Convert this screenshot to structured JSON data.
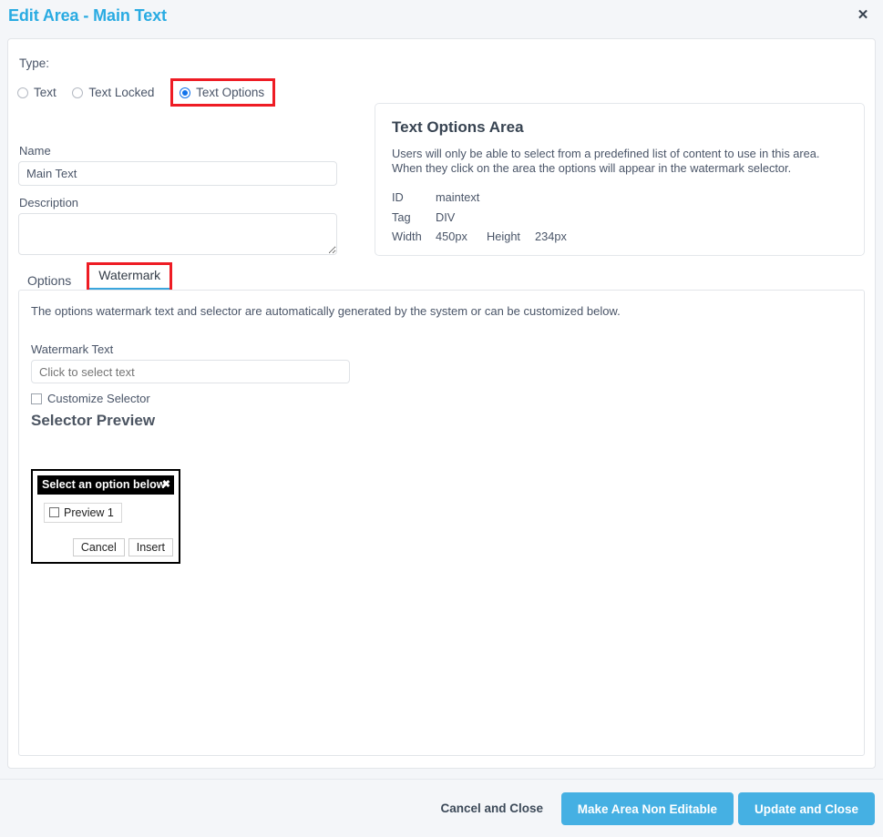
{
  "header": {
    "title": "Edit Area - Main Text",
    "close_icon": "close-icon",
    "close_glyph": "✕"
  },
  "form": {
    "type_label": "Type:",
    "type_options": [
      {
        "label": "Text",
        "selected": false
      },
      {
        "label": "Text Locked",
        "selected": false
      },
      {
        "label": "Text Options",
        "selected": true,
        "highlighted": true
      }
    ],
    "name_label": "Name",
    "name_value": "Main Text",
    "name_placeholder": "",
    "description_label": "Description",
    "description_value": "",
    "description_placeholder": ""
  },
  "info_card": {
    "title": "Text Options Area",
    "description": "Users will only be able to select from a predefined list of content to use in this area. When they click on the area the options will appear in the watermark selector.",
    "rows": [
      {
        "key": "ID",
        "value": "maintext"
      },
      {
        "key": "Tag",
        "value": "DIV"
      }
    ],
    "width_key": "Width",
    "width_value": "450px",
    "height_key": "Height",
    "height_value": "234px"
  },
  "tabs": [
    {
      "label": "Options",
      "active": false
    },
    {
      "label": "Watermark",
      "active": true,
      "highlighted": true
    }
  ],
  "watermark_panel": {
    "note": "The options watermark text and selector are automatically generated by the system or can be customized below.",
    "watermark_text_label": "Watermark Text",
    "watermark_text_value": "",
    "watermark_text_placeholder": "Click to select text",
    "customize_selector_label": "Customize Selector",
    "customize_selector_checked": false,
    "selector_preview_title": "Selector Preview",
    "selector_preview": {
      "header_text": "Select an option below",
      "header_close_glyph": "✖",
      "option_label": "Preview 1",
      "option_checked": false,
      "cancel_label": "Cancel",
      "insert_label": "Insert"
    }
  },
  "footer": {
    "cancel_label": "Cancel and Close",
    "non_editable_label": "Make Area Non Editable",
    "update_label": "Update and Close"
  },
  "colors": {
    "title_blue": "#29abe2",
    "accent_button": "#45b0e3",
    "highlight_red": "#ee1c24",
    "active_tab_underline": "#3ba6dd",
    "radio_selected": "#1273eb",
    "page_background": "#f4f6f9"
  }
}
